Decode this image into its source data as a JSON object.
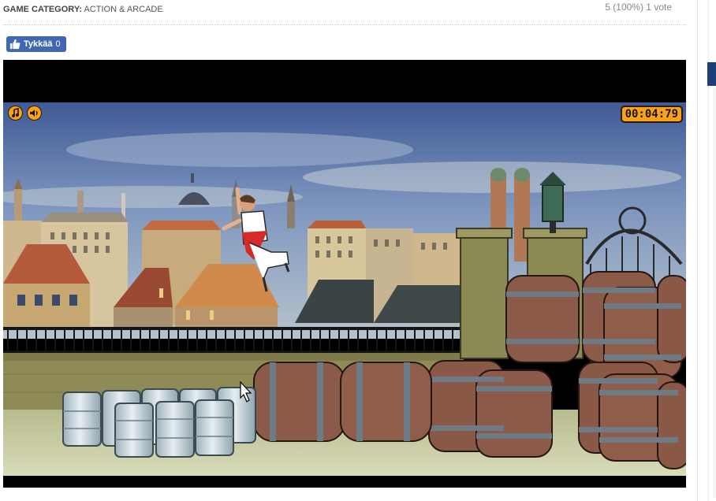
{
  "header": {
    "category_label": "GAME CATEGORY:",
    "category_value": "ACTION & ARCADE",
    "rating": "5 (100%) 1 vote"
  },
  "like_button": {
    "label": "Tykkää",
    "count": "0"
  },
  "game": {
    "timer": "00:04:79",
    "icons": [
      "music-note-icon",
      "sound-icon"
    ]
  },
  "colors": {
    "facebook_blue": "#4267b2",
    "hud_orange": "#f7a21b",
    "sidebar_navy": "#1d3f77"
  }
}
